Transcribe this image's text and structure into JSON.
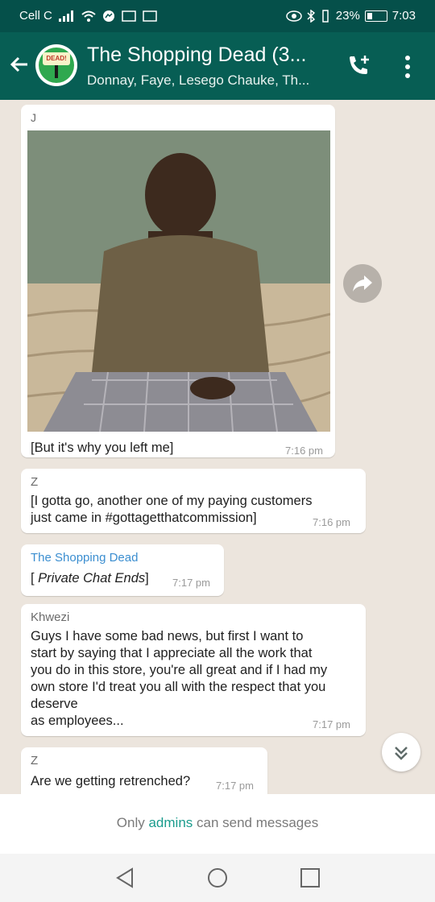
{
  "status_bar": {
    "carrier": "Cell C",
    "battery": "23%",
    "time": "7:03"
  },
  "header": {
    "title": "The Shopping Dead (3...",
    "subtitle": "Donnay, Faye, Lesego Chauke, Th...",
    "avatar_text": "The Shopping Dead"
  },
  "messages": [
    {
      "sender": "J",
      "text": "[But it's why you left me]",
      "time": "7:16 pm"
    },
    {
      "sender": "Z",
      "text_line1": "[I gotta go, another one of my paying customers",
      "text_line2": "just came in #gottagetthatcommission]",
      "time": "7:16 pm"
    },
    {
      "sender": "The Shopping Dead",
      "text_prefix": "[ ",
      "text_italic": "Private Chat Ends",
      "text_suffix": "]",
      "time": "7:17 pm"
    },
    {
      "sender": "Khwezi",
      "lines": [
        "Guys I have some bad news, but first I want to",
        "start by saying that I appreciate all the work that",
        "you do in this store, you're all great and if I had my",
        "own store I'd treat you all with the respect that you",
        "deserve",
        "as employees..."
      ],
      "time": "7:17 pm"
    },
    {
      "sender": "Z",
      "text": "Are we getting retrenched?",
      "time": "7:17 pm"
    }
  ],
  "footer": {
    "prefix": "Only ",
    "link": "admins",
    "suffix": " can send messages"
  },
  "colors": {
    "header_bg": "#075e54",
    "status_bg": "#05504a",
    "accent": "#1a9c8d",
    "chat_bg": "#ece5dd"
  },
  "icons": [
    "back-arrow-icon",
    "add-call-icon",
    "more-vert-icon",
    "forward-icon",
    "scroll-down-icon",
    "nav-back-icon",
    "nav-home-icon",
    "nav-recent-icon"
  ]
}
